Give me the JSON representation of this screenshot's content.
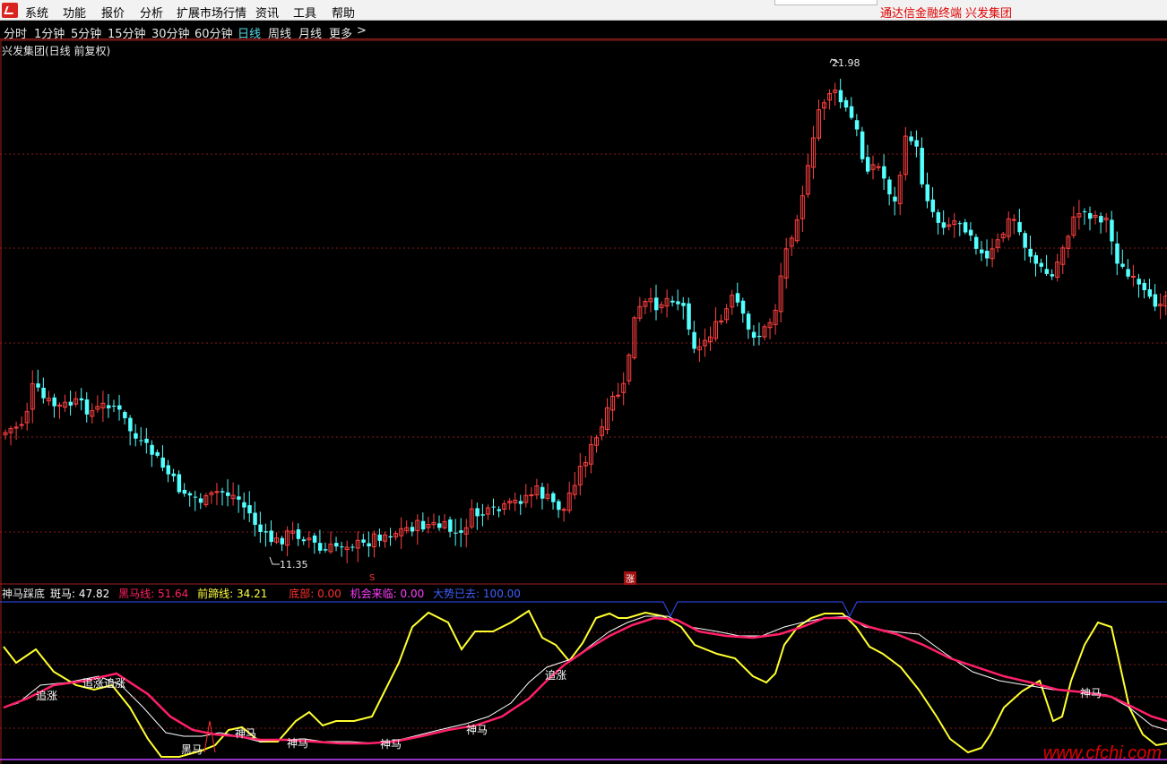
{
  "menu": {
    "items": [
      "系统",
      "功能",
      "报价",
      "分析",
      "扩展市场行情",
      "资讯",
      "工具",
      "帮助"
    ],
    "brand_text": "通达信金融终端",
    "stock_name": "兴发集团"
  },
  "periods": {
    "items": [
      "分时",
      "1分钟",
      "5分钟",
      "15分钟",
      "30分钟",
      "60分钟",
      "日线",
      "周线",
      "月线",
      "更多"
    ],
    "active": "日线",
    "more_arrow": ">"
  },
  "chart": {
    "title": "兴发集团(日线 前复权)",
    "high_label": "21.98",
    "low_label": "11.35",
    "marker_s": "S",
    "marker_zhang": "涨"
  },
  "indicator": {
    "name": "神马踩底",
    "values": [
      {
        "label": "斑马:",
        "value": "47.82",
        "color": "#ffffff"
      },
      {
        "label": "黑马线:",
        "value": "51.64",
        "color": "#ff2060"
      },
      {
        "label": "前蹄线:",
        "value": "34.21",
        "color": "#ffff40"
      },
      {
        "label": "底部:",
        "value": "0.00",
        "color": "#ff3030"
      },
      {
        "label": "机会来临:",
        "value": "0.00",
        "color": "#ff40ff"
      },
      {
        "label": "大势已去:",
        "value": "100.00",
        "color": "#4060ff"
      }
    ],
    "signals": [
      "追涨",
      "追涨追涨",
      "黑马",
      "神马",
      "神马",
      "神马",
      "神马",
      "追涨",
      "神马"
    ]
  },
  "watermark": "www.cfchi.com",
  "colors": {
    "up": "#ff4040",
    "down": "#54ffff",
    "grid": "#8a1a1a",
    "white_line": "#ffffff",
    "pink_line": "#ff2068",
    "yellow_line": "#ffff30",
    "blue_line": "#3050ff",
    "purple_line": "#c040ff"
  }
}
